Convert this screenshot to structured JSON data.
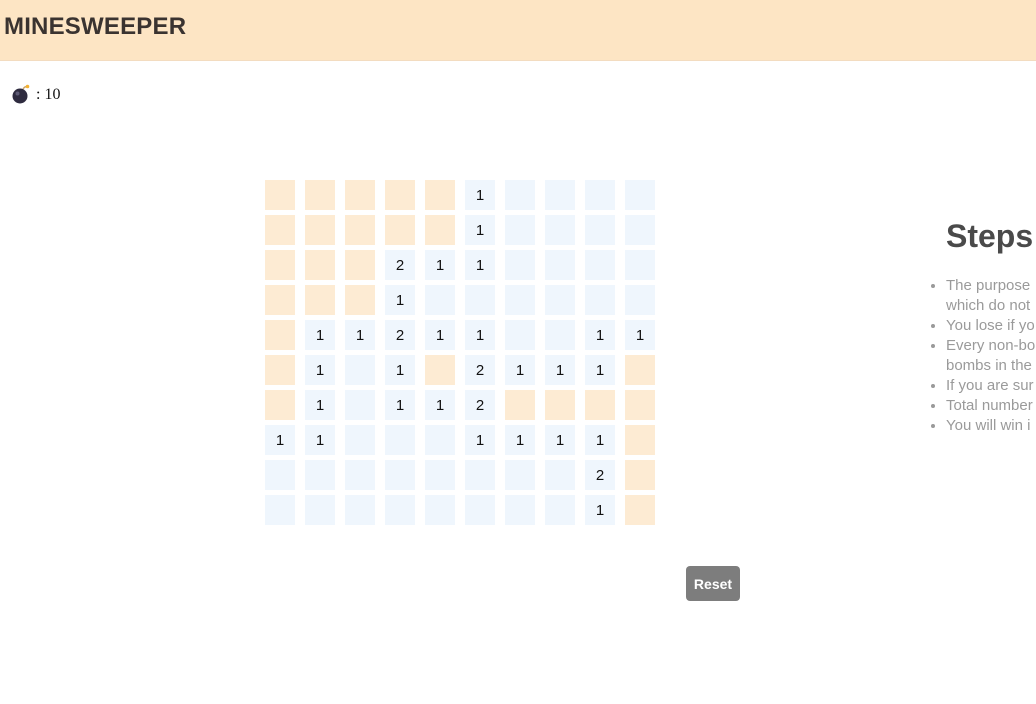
{
  "header": {
    "title": "MINESWEEPER"
  },
  "counter": {
    "icon": "bomb-icon",
    "separator": ":",
    "value": "10"
  },
  "board": {
    "rows": 10,
    "cols": 10,
    "cells": [
      [
        "h",
        "h",
        "h",
        "h",
        "h",
        "1",
        "r",
        "r",
        "r",
        "r"
      ],
      [
        "h",
        "h",
        "h",
        "h",
        "h",
        "1",
        "r",
        "r",
        "r",
        "r"
      ],
      [
        "h",
        "h",
        "h",
        "2",
        "1",
        "1",
        "r",
        "r",
        "r",
        "r"
      ],
      [
        "h",
        "h",
        "h",
        "1",
        "r",
        "r",
        "r",
        "r",
        "r",
        "r"
      ],
      [
        "h",
        "1",
        "1",
        "2",
        "1",
        "1",
        "r",
        "r",
        "1",
        "1"
      ],
      [
        "h",
        "1",
        "r",
        "1",
        "h",
        "2",
        "1",
        "1",
        "1",
        "h"
      ],
      [
        "h",
        "1",
        "r",
        "1",
        "1",
        "2",
        "h",
        "h",
        "h",
        "h"
      ],
      [
        "1",
        "1",
        "r",
        "r",
        "r",
        "1",
        "1",
        "1",
        "1",
        "h"
      ],
      [
        "r",
        "r",
        "r",
        "r",
        "r",
        "r",
        "r",
        "r",
        "2",
        "h"
      ],
      [
        "r",
        "r",
        "r",
        "r",
        "r",
        "r",
        "r",
        "r",
        "1",
        "h"
      ]
    ]
  },
  "reset": {
    "label": "Reset"
  },
  "steps": {
    "title": "Steps",
    "items": [
      "The purpose",
      "which do not",
      "You lose if yo",
      "Every non-bo",
      "bombs in the",
      "If you are sur",
      "Total number",
      "You will win i"
    ]
  },
  "colors": {
    "header_bg": "#fde5c4",
    "hidden_cell": "#fdebd3",
    "revealed_cell": "#eff6fd",
    "reset_bg": "#7d7d7d",
    "steps_text": "#9a9a9a"
  }
}
